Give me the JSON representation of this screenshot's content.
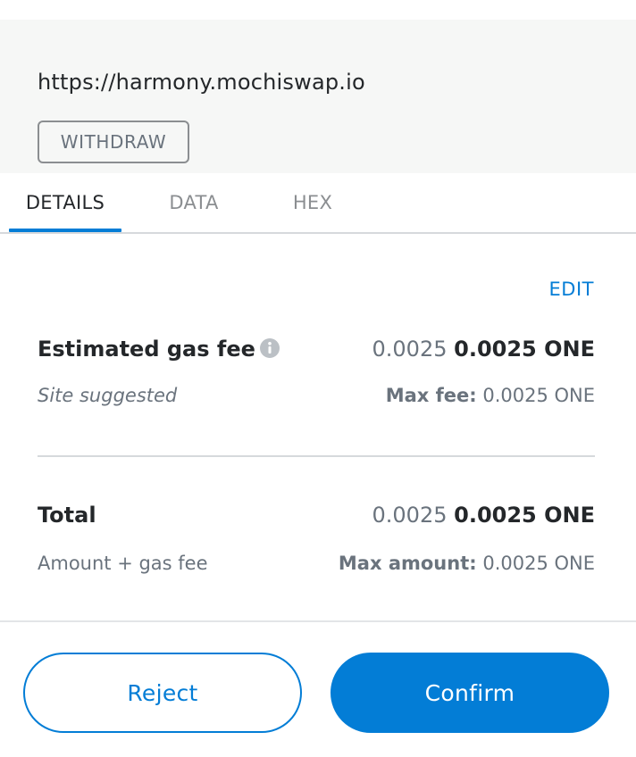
{
  "origin": {
    "url": "https://harmony.mochiswap.io",
    "method_label": "WITHDRAW"
  },
  "tabs": [
    {
      "label": "DETAILS",
      "active": true
    },
    {
      "label": "DATA",
      "active": false
    },
    {
      "label": "HEX",
      "active": false
    }
  ],
  "details": {
    "edit_label": "EDIT",
    "gas": {
      "label": "Estimated gas fee",
      "info_icon": "info-circle-icon",
      "secondary_value": "0.0025",
      "primary_value": "0.0025 ONE",
      "sublabel": "Site suggested",
      "max_label": "Max fee:",
      "max_value": "0.0025 ONE"
    },
    "total": {
      "label": "Total",
      "secondary_value": "0.0025",
      "primary_value": "0.0025 ONE",
      "sublabel": "Amount + gas fee",
      "max_label": "Max amount:",
      "max_value": "0.0025 ONE"
    }
  },
  "footer": {
    "reject_label": "Reject",
    "confirm_label": "Confirm"
  },
  "colors": {
    "accent": "#037dd6",
    "panel_bg": "#f6f7f6",
    "text_primary": "#24272a",
    "text_muted": "#6a737d"
  }
}
